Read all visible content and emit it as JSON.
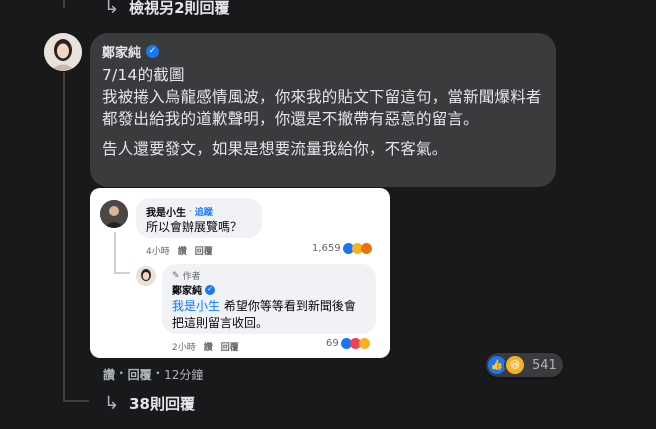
{
  "top_reply_link": "檢視另2則回覆",
  "comment": {
    "author": "鄭家純",
    "paragraphs": [
      "7/14的截圖",
      "我被捲入烏龍感情風波，你來我的貼文下留這句，當新聞爆料者都發出給我的道歉聲明，你還是不撤帶有惡意的留言。",
      "告人還要發文，如果是想要流量我給你，不客氣。"
    ],
    "actions": {
      "like": "讚",
      "reply": "回覆",
      "time": "12分鐘"
    },
    "reactions_count": "541"
  },
  "screenshot": {
    "comment1": {
      "author": "我是小生",
      "follow": "追蹤",
      "text": "所以會辦展覽嗎？",
      "time": "4小時",
      "like": "讚",
      "reply": "回覆",
      "count": "1,659"
    },
    "comment2": {
      "badge": "作者",
      "author": "鄭家純",
      "mention": "我是小生",
      "text_line1": "希望你等等看到新聞後會",
      "text_line2": "把這則留言收回。",
      "time": "2小時",
      "like": "讚",
      "reply": "回覆",
      "count": "69"
    }
  },
  "bottom_reply_link": "38則回覆",
  "colors": {
    "background": "#18191a",
    "bubble": "#3a3b3c",
    "verified": "#1877f2"
  }
}
